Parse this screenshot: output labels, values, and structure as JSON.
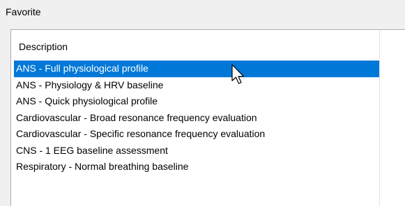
{
  "group": {
    "title": "Favorite"
  },
  "list": {
    "column_header": "Description",
    "selected_index": 0,
    "items": [
      {
        "label": "ANS - Full physiological profile"
      },
      {
        "label": "ANS - Physiology & HRV baseline"
      },
      {
        "label": "ANS - Quick physiological profile"
      },
      {
        "label": "Cardiovascular - Broad resonance frequency evaluation"
      },
      {
        "label": "Cardiovascular - Specific resonance frequency evaluation"
      },
      {
        "label": "CNS - 1 EEG baseline assessment"
      },
      {
        "label": "Respiratory - Normal breathing baseline"
      }
    ]
  },
  "colors": {
    "selection": "#0078d7",
    "background": "#f0f0f0",
    "list_background": "#ffffff"
  },
  "icons": {
    "cursor": "mouse-pointer-icon"
  }
}
